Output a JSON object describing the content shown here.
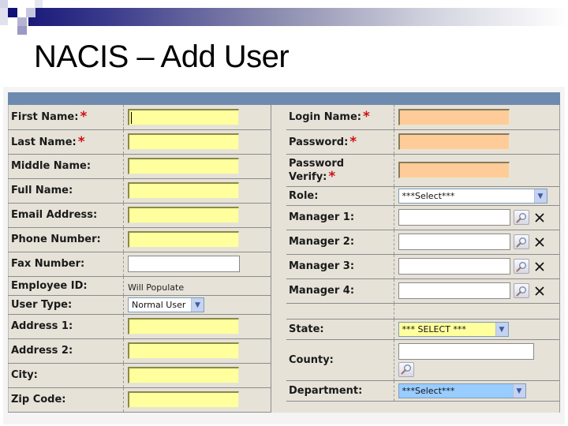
{
  "slide": {
    "title": "NACIS – Add User"
  },
  "left_fields": [
    {
      "label": "First Name:",
      "required": true,
      "type": "text",
      "style": "yellow",
      "value": ""
    },
    {
      "label": "Last Name:",
      "required": true,
      "type": "text",
      "style": "yellow",
      "value": ""
    },
    {
      "label": "Middle Name:",
      "required": false,
      "type": "text",
      "style": "yellow",
      "value": ""
    },
    {
      "label": "Full Name:",
      "required": false,
      "type": "text",
      "style": "yellow",
      "value": ""
    },
    {
      "label": "Email Address:",
      "required": false,
      "type": "text",
      "style": "yellow",
      "value": ""
    },
    {
      "label": "Phone Number:",
      "required": false,
      "type": "text",
      "style": "yellow",
      "value": ""
    },
    {
      "label": "Fax Number:",
      "required": false,
      "type": "text",
      "style": "white",
      "value": ""
    },
    {
      "label": "Employee ID:",
      "required": false,
      "type": "static",
      "value": "Will Populate"
    },
    {
      "label": "User Type:",
      "required": false,
      "type": "select",
      "value": "Normal User"
    },
    {
      "label": "Address 1:",
      "required": false,
      "type": "text",
      "style": "yellow",
      "value": ""
    },
    {
      "label": "Address 2:",
      "required": false,
      "type": "text",
      "style": "yellow",
      "value": ""
    },
    {
      "label": "City:",
      "required": false,
      "type": "text",
      "style": "yellow",
      "value": ""
    },
    {
      "label": "Zip Code:",
      "required": false,
      "type": "text",
      "style": "yellow",
      "value": ""
    }
  ],
  "right_fields": {
    "login_name": {
      "label": "Login Name:",
      "required": true,
      "value": ""
    },
    "password": {
      "label": "Password:",
      "required": true,
      "value": ""
    },
    "password_verify": {
      "label_line1": "Password",
      "label_line2": "Verify:",
      "required": true,
      "value": ""
    },
    "role": {
      "label": "Role:",
      "value": "***Select***"
    },
    "managers": [
      {
        "label": "Manager 1:",
        "value": ""
      },
      {
        "label": "Manager 2:",
        "value": ""
      },
      {
        "label": "Manager 3:",
        "value": ""
      },
      {
        "label": "Manager 4:",
        "value": ""
      }
    ],
    "state": {
      "label": "State:",
      "value": "*** SELECT ***"
    },
    "county": {
      "label": "County:",
      "value": ""
    },
    "department": {
      "label": "Department:",
      "value": "***Select***"
    }
  },
  "required_marker": "*",
  "icons": {
    "lookup": "magnifier-icon",
    "clear": "x-icon",
    "dropdown": "chevron-down-icon"
  },
  "colors": {
    "required_fill": "#ffff9e",
    "login_fill": "#ffcc99",
    "header_bar": "#6e8aae",
    "department_fill": "#99ccff",
    "required_marker": "#cc1111"
  }
}
